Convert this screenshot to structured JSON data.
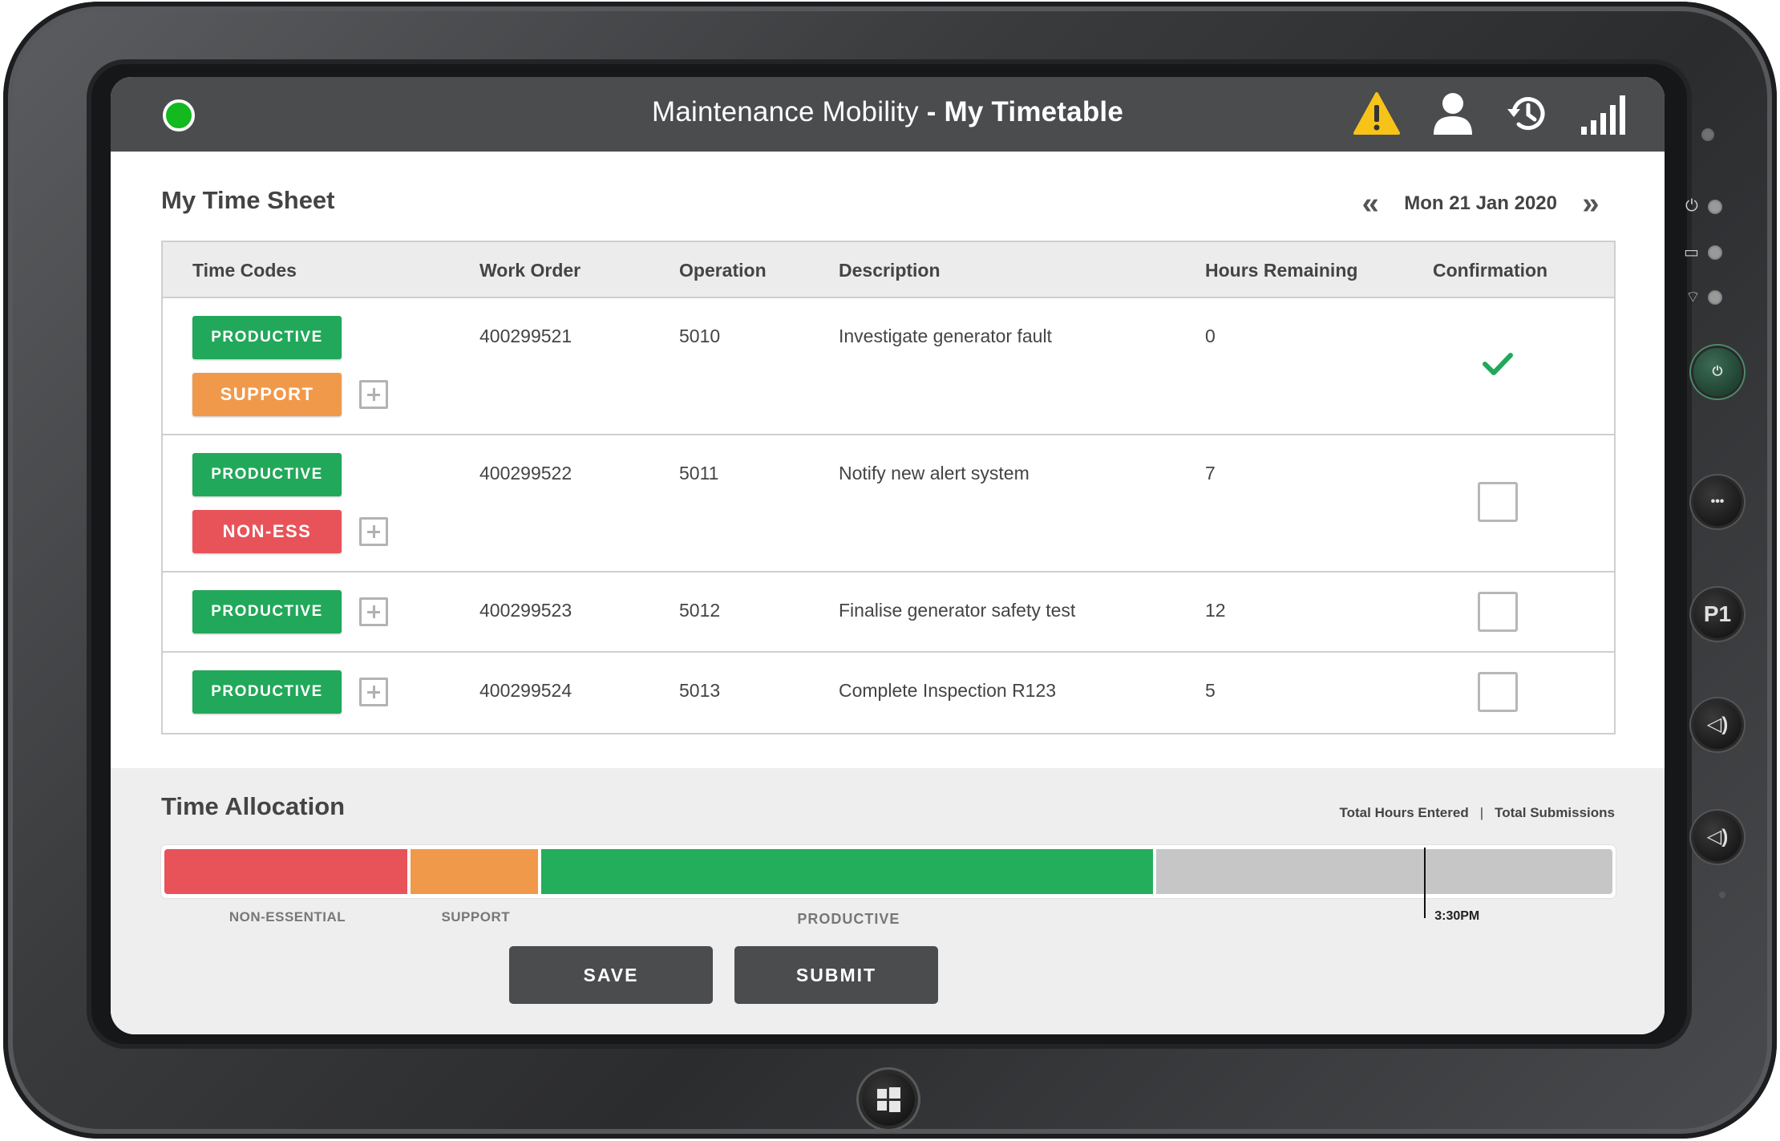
{
  "app": {
    "title_prefix": "Maintenance Mobility",
    "title_sep": " - ",
    "title_page": "My Timetable",
    "icons": [
      "status-online-icon",
      "warning-icon",
      "user-icon",
      "history-icon",
      "signal-icon"
    ],
    "status_color": "#13b91e"
  },
  "timesheet": {
    "title": "My Time Sheet",
    "prev_symbol": "«",
    "next_symbol": "»",
    "date": "Mon 21 Jan 2020"
  },
  "table": {
    "headers": {
      "time_codes": "Time Codes",
      "work_order": "Work Order",
      "operation": "Operation",
      "description": "Description",
      "hours_remaining": "Hours Remaining",
      "confirmation": "Confirmation"
    },
    "rows": [
      {
        "codes": [
          "PRODUCTIVE",
          "SUPPORT"
        ],
        "work_order": "400299521",
        "operation": "5010",
        "description": "Investigate generator fault",
        "hours_remaining": "0",
        "confirmed": true
      },
      {
        "codes": [
          "PRODUCTIVE",
          "NON-ESS"
        ],
        "work_order": "400299522",
        "operation": "5011",
        "description": "Notify new alert system",
        "hours_remaining": "7",
        "confirmed": false
      },
      {
        "codes": [
          "PRODUCTIVE"
        ],
        "work_order": "400299523",
        "operation": "5012",
        "description": "Finalise generator safety test",
        "hours_remaining": "12",
        "confirmed": false
      },
      {
        "codes": [
          "PRODUCTIVE"
        ],
        "work_order": "400299524",
        "operation": "5013",
        "description": "Complete Inspection R123",
        "hours_remaining": "5",
        "confirmed": false
      }
    ]
  },
  "allocation": {
    "title": "Time Allocation",
    "total_hours_label": "Total Hours Entered",
    "separator": "|",
    "total_submissions_label": "Total Submissions",
    "segments": [
      {
        "label": "NON-ESSENTIAL",
        "fraction": 0.17,
        "color": "#e8535a"
      },
      {
        "label": "SUPPORT",
        "fraction": 0.09,
        "color": "#f1994a"
      },
      {
        "label": "PRODUCTIVE",
        "fraction": 0.425,
        "color": "#22ae5b"
      },
      {
        "label": "",
        "fraction": 0.315,
        "color": "#c6c6c6"
      }
    ],
    "marker_time": "3:30PM",
    "marker_fraction": 0.87
  },
  "actions": {
    "save": "SAVE",
    "submit": "SUBMIT"
  },
  "colors": {
    "productive": "#22a85a",
    "support": "#f1994a",
    "non_essential": "#e8535a",
    "header_bar": "#4b4c4e",
    "check": "#22a85a"
  }
}
